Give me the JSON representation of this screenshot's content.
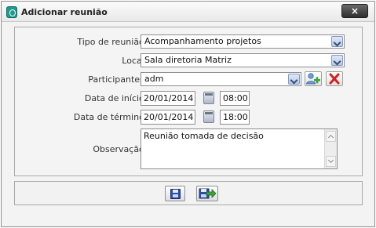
{
  "window": {
    "title": "Adicionar reunião",
    "close_label": "×"
  },
  "form": {
    "tipo": {
      "label": "Tipo de reunião :",
      "value": "Acompanhamento projetos"
    },
    "local": {
      "label": "Local :",
      "value": "Sala diretoria Matriz"
    },
    "participantes": {
      "label": "Participantes :",
      "value": "adm"
    },
    "inicio": {
      "label": "Data de início :",
      "date": "20/01/2014",
      "time": "08:00"
    },
    "termino": {
      "label": "Data de término :",
      "date": "20/01/2014",
      "time": "18:00"
    },
    "observacao": {
      "label": "Observação :",
      "value": "Reunião tomada de decisão"
    }
  },
  "icons": {
    "app": "app-logo-icon",
    "add_participant": "add-user-icon",
    "remove_participant": "red-x-icon",
    "calendar": "calendar-icon",
    "save": "floppy-disk-icon",
    "save_exit": "save-and-exit-icon"
  },
  "colors": {
    "accent": "#1f9a8c",
    "remove": "#d62020",
    "add": "#3fa23a"
  }
}
